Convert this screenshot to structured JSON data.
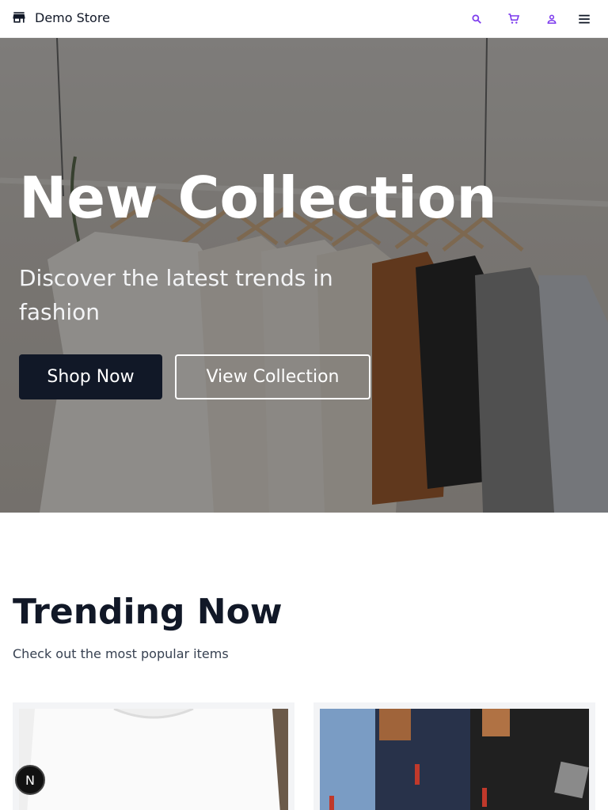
{
  "header": {
    "brand": "Demo Store",
    "icons": [
      "store-icon",
      "search-icon",
      "cart-icon",
      "user-icon",
      "menu-icon"
    ],
    "accent": "#7c3aed"
  },
  "hero": {
    "title": "New Collection",
    "subtitle": "Discover the latest trends in fashion",
    "primary_button": "Shop Now",
    "secondary_button": "View Collection",
    "button_color": "#111827"
  },
  "trending": {
    "title": "Trending Now",
    "subtitle": "Check out the most popular items"
  },
  "dev_badge": {
    "label": "N"
  }
}
